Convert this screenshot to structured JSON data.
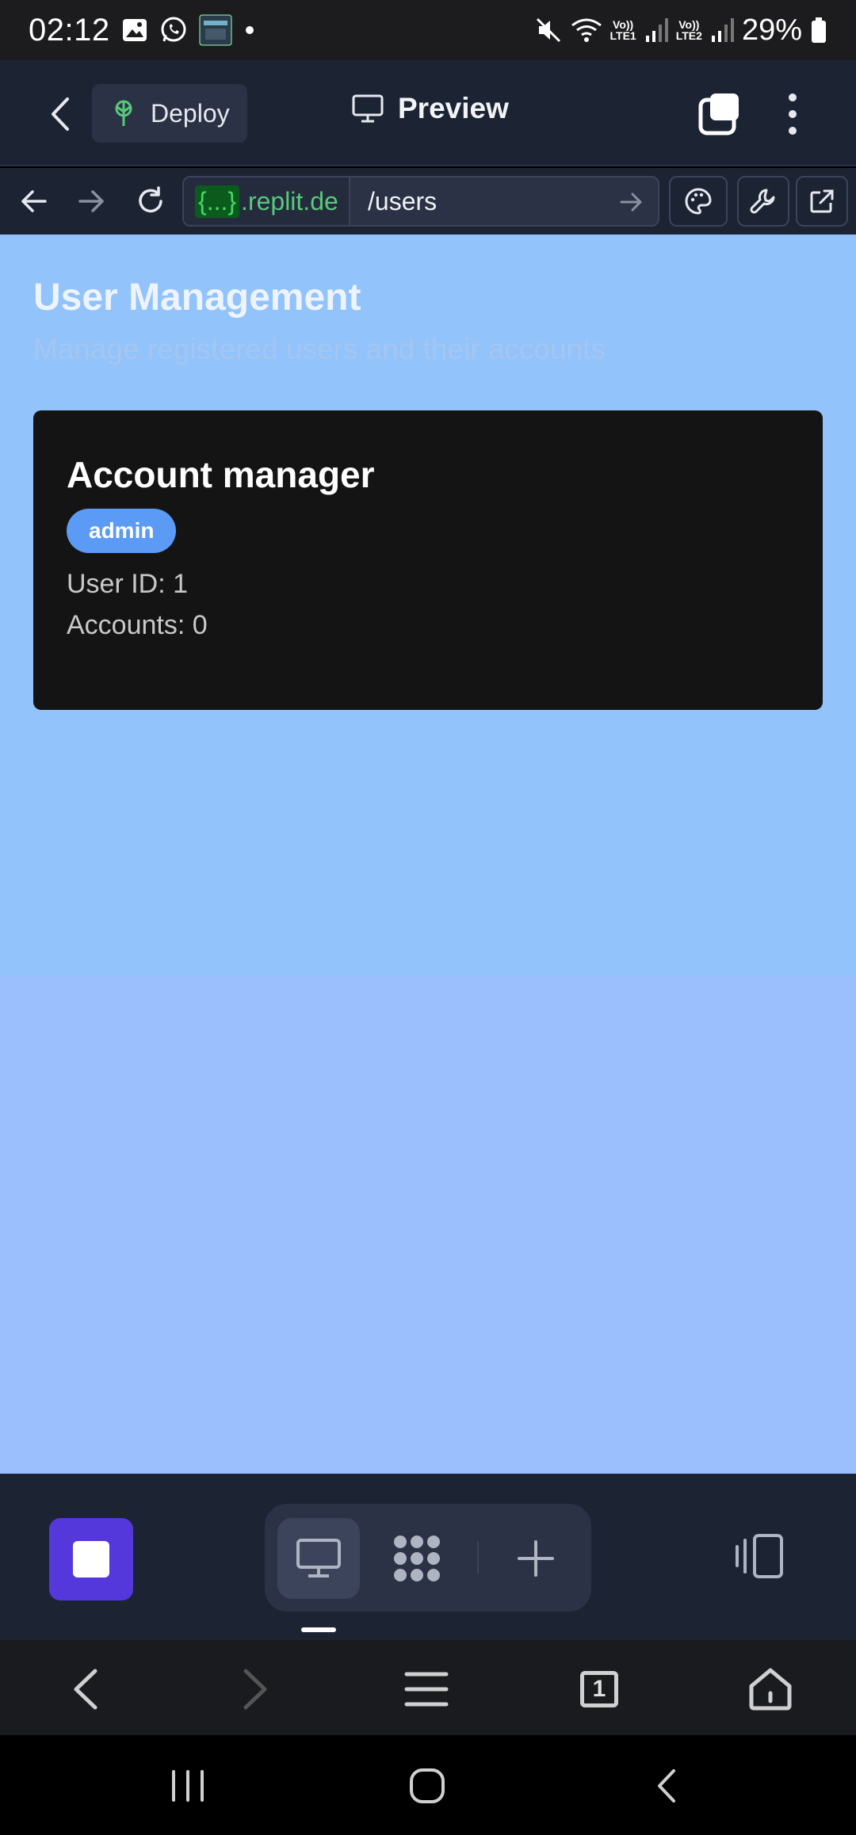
{
  "status_bar": {
    "time": "02:12",
    "battery_percent": "29%",
    "sim1": "LTE1",
    "sim2": "LTE2",
    "volte": "Vo))"
  },
  "top_bar": {
    "deploy_label": "Deploy",
    "preview_label": "Preview"
  },
  "url_bar": {
    "domain_code": "{...}",
    "domain_host": ".replit.de",
    "path": "/users"
  },
  "page": {
    "title": "User Management",
    "subtitle": "Manage registered users and their accounts",
    "users": [
      {
        "name": "Account manager",
        "role": "admin",
        "user_id_line": "User ID: 1",
        "accounts_line": "Accounts: 0"
      }
    ]
  },
  "browser_nav": {
    "tab_count": "1"
  },
  "colors": {
    "page_background": "#92c3fb",
    "card_background": "#141414",
    "badge": "#5b9af5",
    "stop_button": "#5438dc",
    "toolbar": "#1c2333"
  },
  "icons": [
    "image-icon",
    "whatsapp-icon",
    "game-thumbnail-icon",
    "mute-icon",
    "wifi-icon",
    "signal-icon",
    "battery-icon",
    "chevron-left-icon",
    "deploy-icon",
    "monitor-icon",
    "tabs-icon",
    "kebab-menu-icon",
    "arrow-left-icon",
    "arrow-right-icon",
    "refresh-icon",
    "palette-icon",
    "wrench-icon",
    "external-link-icon",
    "stop-icon",
    "dots-grid-icon",
    "plus-icon",
    "layout-toggle-icon",
    "menu-icon",
    "home-icon",
    "recents-icon"
  ]
}
